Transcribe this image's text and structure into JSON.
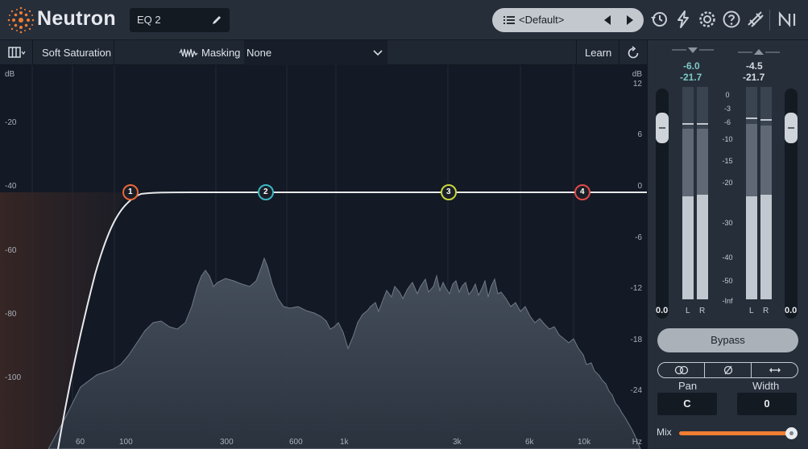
{
  "app": {
    "name": "Neutron"
  },
  "module": {
    "name": "EQ 2"
  },
  "preset": {
    "name": "<Default>"
  },
  "toolbar": {
    "mode_label": "Soft Saturation",
    "masking_label": "Masking",
    "masking_source": "None",
    "learn_label": "Learn"
  },
  "eq": {
    "db_unit": "dB",
    "hz_unit": "Hz",
    "left_scale": [
      "-20",
      "-40",
      "-60",
      "-80",
      "-100"
    ],
    "right_scale": [
      "12",
      "6",
      "0",
      "-6",
      "-12",
      "-18",
      "-24"
    ],
    "freq_labels": [
      "60",
      "100",
      "300",
      "600",
      "1k",
      "3k",
      "6k",
      "10k"
    ],
    "nodes": [
      {
        "label": "1",
        "color": "#e8663a"
      },
      {
        "label": "2",
        "color": "#3cb6c3"
      },
      {
        "label": "3",
        "color": "#c6d43c"
      },
      {
        "label": "4",
        "color": "#e04a4a"
      }
    ]
  },
  "meters": {
    "input_peak": "-6.0",
    "input_rms": "-21.7",
    "output_peak": "-4.5",
    "output_rms": "-21.7",
    "input_gain": "0.0",
    "output_gain": "0.0",
    "scale": [
      "0",
      "-3",
      "-6",
      "-10",
      "-15",
      "-20",
      "-30",
      "-40",
      "-50",
      "-Inf"
    ],
    "channel_left": "L",
    "channel_right": "R",
    "input_fill": 0.58,
    "output_fill": 0.58
  },
  "controls": {
    "bypass_label": "Bypass",
    "pan_label": "Pan",
    "pan_value": "C",
    "width_label": "Width",
    "width_value": "0",
    "mix_label": "Mix",
    "mix_value": 1.0
  },
  "colors": {
    "accent": "#ef7d32",
    "peak_value": "#c9d4dc",
    "rms_value": "#7ec8c8"
  }
}
